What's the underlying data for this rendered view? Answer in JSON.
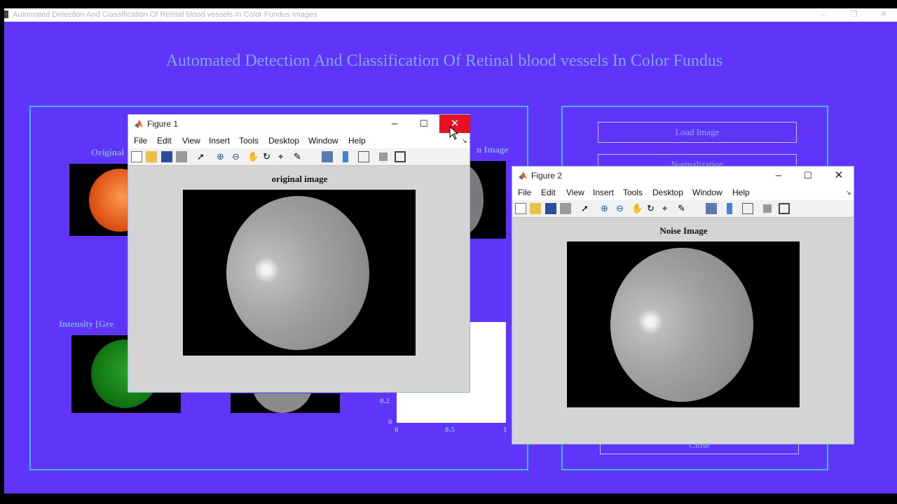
{
  "main_window": {
    "title": "Automated Detection And Classification Of Retinal blood vessels In Color Fundus Images",
    "heading": "Automated Detection And Classification Of Retinal blood vessels In Color Fundus",
    "window_controls": [
      "–",
      "❐",
      "✕"
    ],
    "axes_titles": {
      "original": "Original",
      "intensity": "Intensity [Gre",
      "noise_right": "n Image"
    },
    "buttons": {
      "load": "Load Image",
      "normalization": "Normalization",
      "close": "Close"
    },
    "plot_ticks": {
      "y": [
        "0.2",
        "0"
      ],
      "x": [
        "0",
        "0.5",
        "1"
      ]
    },
    "colors": {
      "background": "#6134fa",
      "panel_border": "#3fb8e6",
      "text": "#7aa8f0"
    }
  },
  "figure1": {
    "title": "Figure 1",
    "menu": [
      "File",
      "Edit",
      "View",
      "Insert",
      "Tools",
      "Desktop",
      "Window",
      "Help"
    ],
    "plot_title": "original image",
    "close_highlight": "#e81123"
  },
  "figure2": {
    "title": "Figure 2",
    "menu": [
      "File",
      "Edit",
      "View",
      "Insert",
      "Tools",
      "Desktop",
      "Window",
      "Help"
    ],
    "plot_title": "Noise Image"
  },
  "toolbar_icons": [
    "new-file-icon",
    "open-folder-icon",
    "save-icon",
    "print-icon",
    "pointer-icon",
    "zoom-in-icon",
    "zoom-out-icon",
    "pan-hand-icon",
    "rotate-3d-icon",
    "data-cursor-icon",
    "brush-icon",
    "link-plot-icon",
    "colorbar-icon",
    "legend-icon",
    "hide-plot-tools-icon",
    "show-plot-tools-icon"
  ]
}
